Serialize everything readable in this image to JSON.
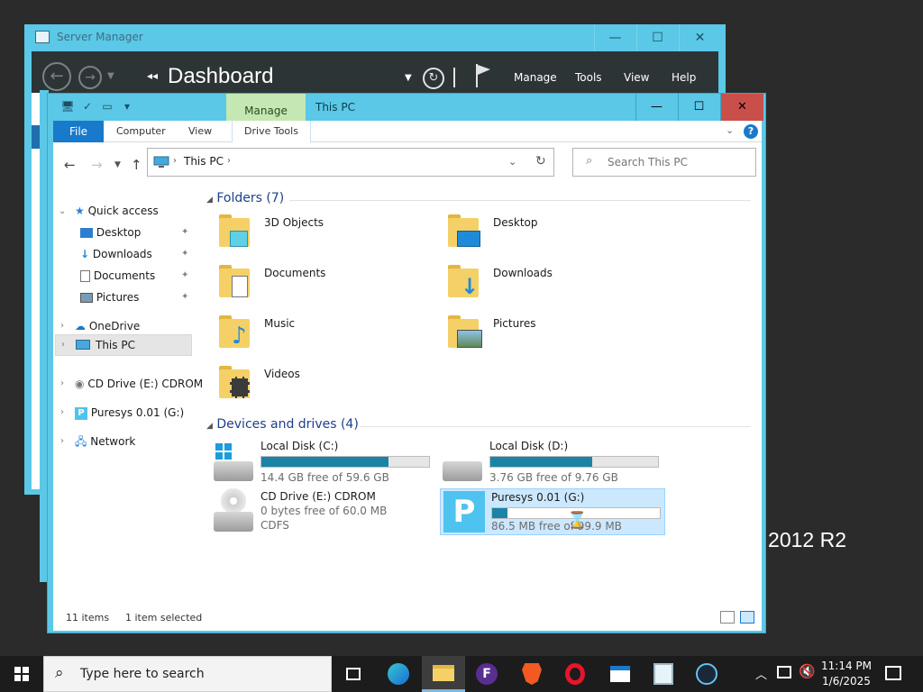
{
  "server_manager": {
    "title": "Server Manager",
    "dashboard_arrows": "◂◂",
    "dashboard": "Dashboard",
    "menus": [
      "Manage",
      "Tools",
      "View",
      "Help"
    ],
    "brand_partial": "r 2012 R2"
  },
  "explorer": {
    "title": "This PC",
    "manage_tab": "Manage",
    "ribbon": {
      "file": "File",
      "computer": "Computer",
      "view": "View",
      "drive_tools": "Drive Tools"
    },
    "address": {
      "path": "This PC"
    },
    "search": {
      "placeholder": "Search This PC"
    },
    "nav": {
      "quick_access": "Quick access",
      "desktop": "Desktop",
      "downloads": "Downloads",
      "documents": "Documents",
      "pictures": "Pictures",
      "onedrive": "OneDrive",
      "this_pc": "This PC",
      "cd_drive": "CD Drive (E:) CDROM",
      "puresys": "Puresys 0.01 (G:)",
      "network": "Network"
    },
    "folders_header": "Folders (7)",
    "folders": [
      "3D Objects",
      "Desktop",
      "Documents",
      "Downloads",
      "Music",
      "Pictures",
      "Videos"
    ],
    "devices_header": "Devices and drives (4)",
    "drives": {
      "c": {
        "name": "Local Disk (C:)",
        "free": "14.4 GB free of 59.6 GB",
        "used_fraction": 0.76
      },
      "d": {
        "name": "Local Disk (D:)",
        "free": "3.76 GB free of 9.76 GB",
        "used_fraction": 0.61
      },
      "e": {
        "name": "CD Drive (E:) CDROM",
        "free": "0 bytes free of 60.0 MB",
        "fs": "CDFS"
      },
      "g": {
        "name": "Puresys 0.01 (G:)",
        "free": "86.5 MB free of 99.9 MB",
        "used_fraction": 0.09
      }
    },
    "status": {
      "items": "11 items",
      "selected": "1 item selected"
    }
  },
  "taskbar": {
    "search_placeholder": "Type here to search",
    "time": "11:14 PM",
    "date": "1/6/2025"
  },
  "colors": {
    "window_frame": "#5ac8e6",
    "accent": "#1979ca",
    "close_red": "#c9504a",
    "drive_bar": "#1b84a6"
  }
}
